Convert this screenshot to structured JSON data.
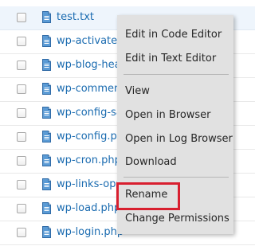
{
  "files": [
    {
      "name": "test.txt"
    },
    {
      "name": "wp-activate.php"
    },
    {
      "name": "wp-blog-header.php"
    },
    {
      "name": "wp-comments-post.php"
    },
    {
      "name": "wp-config-sample.php"
    },
    {
      "name": "wp-config.php"
    },
    {
      "name": "wp-cron.php"
    },
    {
      "name": "wp-links-opml.php"
    },
    {
      "name": "wp-load.php"
    },
    {
      "name": "wp-login.php"
    }
  ],
  "context_menu": {
    "items": [
      {
        "label": "Edit in Code Editor"
      },
      {
        "label": "Edit in Text Editor"
      },
      {
        "label": "View"
      },
      {
        "label": "Open in Browser"
      },
      {
        "label": "Open in Log Browser"
      },
      {
        "label": "Download"
      },
      {
        "label": "Rename"
      },
      {
        "label": "Change Permissions"
      }
    ]
  },
  "colors": {
    "link": "#1a6bb0",
    "highlight_border": "#d81f2f",
    "menu_background": "#e1e1e1",
    "selected_row": "#eef5fc"
  },
  "icons": {
    "file": "file-document-icon"
  }
}
